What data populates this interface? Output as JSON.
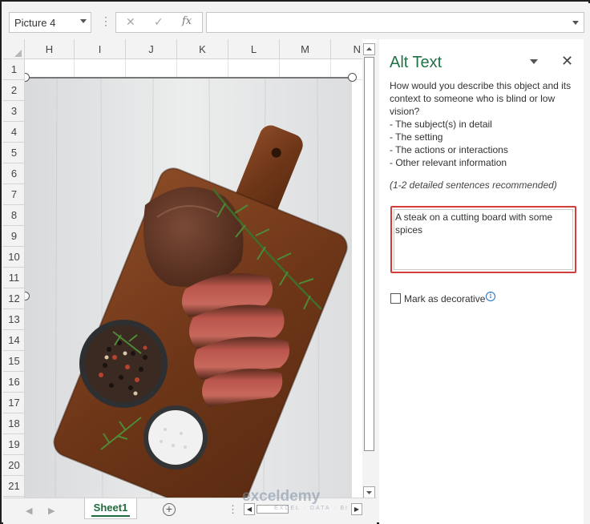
{
  "formula_bar": {
    "name_box": "Picture 4",
    "cancel_icon": "✕",
    "enter_icon": "✓",
    "fx_icon": "fx",
    "formula_value": ""
  },
  "grid": {
    "columns": [
      "H",
      "I",
      "J",
      "K",
      "L",
      "M",
      "N"
    ],
    "rows": [
      "1",
      "2",
      "3",
      "4",
      "5",
      "6",
      "7",
      "8",
      "9",
      "10",
      "11",
      "12",
      "13",
      "14",
      "15",
      "16",
      "17",
      "18",
      "19",
      "20",
      "21"
    ]
  },
  "tabs": {
    "active_sheet": "Sheet1",
    "add_sheet": "+",
    "options": "⋮"
  },
  "watermark": {
    "brand": "exceldemy",
    "tagline": "EXCEL · DATA · BI"
  },
  "alt_text_pane": {
    "title": "Alt Text",
    "close": "✕",
    "description_lines": [
      "How would you describe this object and its",
      "context to someone who is blind or low",
      "vision?",
      "- The subject(s) in detail",
      "- The setting",
      "- The actions or interactions",
      "- Other relevant information"
    ],
    "hint": "(1-2 detailed sentences recommended)",
    "alt_text_value": "A steak on a cutting board with some spices",
    "decorative_label": "Mark as decorative",
    "info_icon": "i"
  },
  "colors": {
    "accent_green": "#217346",
    "highlight_red": "#d43b3b",
    "info_blue": "#1f6fc4"
  }
}
